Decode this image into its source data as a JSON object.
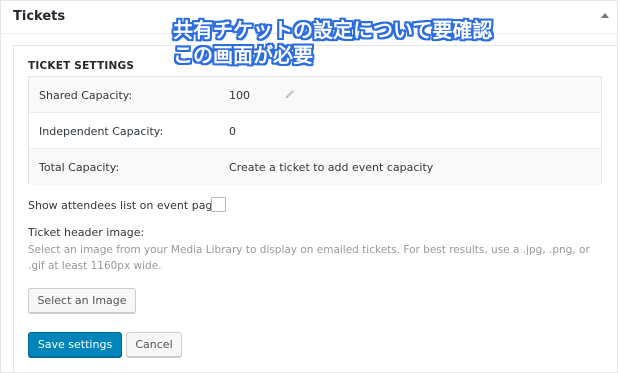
{
  "postbox": {
    "title": "Tickets"
  },
  "settings": {
    "section_title": "TICKET SETTINGS",
    "rows": [
      {
        "label": "Shared Capacity:",
        "value": "100"
      },
      {
        "label": "Independent Capacity:",
        "value": "0"
      },
      {
        "label": "Total Capacity:",
        "value": "Create a ticket to add event capacity"
      }
    ],
    "attendees_label": "Show attendees list on event page",
    "attendees_checked": false,
    "header_image_label": "Ticket header image:",
    "header_image_help": "Select an image from your Media Library to display on emailed tickets. For best results, use a .jpg, .png, or .gif at least 1160px wide.",
    "select_image_button": "Select an Image",
    "save_button": "Save settings",
    "cancel_button": "Cancel"
  },
  "annotation": {
    "line1": "共有チケットの設定について要確認",
    "line2": "この画面が必要"
  },
  "colors": {
    "primary": "#0085ba",
    "annotation_outline": "#2b6de0"
  },
  "icons": {
    "collapse": "triangle-up-icon",
    "edit": "pencil-icon"
  }
}
